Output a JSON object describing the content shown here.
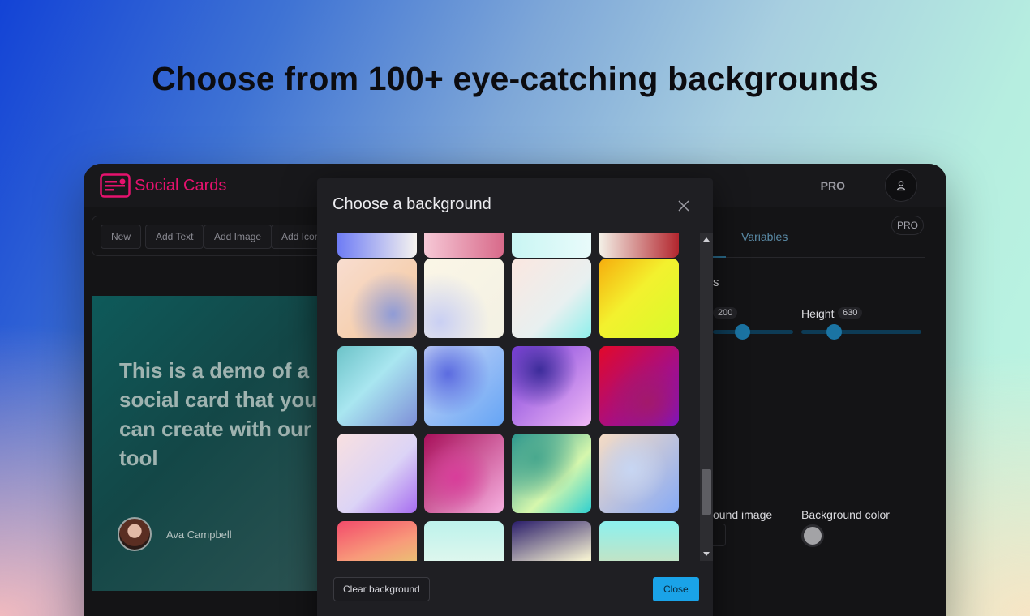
{
  "headline": "Choose from 100+ eye-catching backgrounds",
  "app": {
    "logo_text": "Social Cards",
    "pro_label": "PRO",
    "toolbar": [
      "New",
      "Add Text",
      "Add Image",
      "Add Icon"
    ]
  },
  "card": {
    "text": "This is a demo of a\nsocial card that you\ncan create with our\ntool",
    "author": "Ava Campbell"
  },
  "right_panel": {
    "pro_badge": "PRO",
    "tab_variables": "Variables",
    "section_fragment": "s",
    "width_value_fragment": "200",
    "height_label": "Height",
    "height_value": "630",
    "bg_image_label_fragment": "ound image",
    "bg_color_label": "Background color",
    "bg_color": "#a3a3a6",
    "width_slider_fraction": 0.34,
    "height_slider_fraction": 0.27
  },
  "modal": {
    "title": "Choose a background",
    "clear_label": "Clear background",
    "close_label": "Close",
    "scroll_fraction": 0.85,
    "tiles": [
      [
        "linear-gradient(90deg,#6e7cf5,#f6f3ef)",
        "linear-gradient(90deg,#f6c8d6,#d86a8a)",
        "linear-gradient(90deg,#c9f6f3,#e9fbfb)",
        "linear-gradient(90deg,#f3efe6,#b3262e)"
      ],
      [
        "radial-gradient(circle at 70% 70%,#8f9bd6,transparent 55%),linear-gradient(135deg,#f8ddd0,#f4c79a)",
        "radial-gradient(circle at 20% 80%,#c9cff3,transparent 55%),linear-gradient(135deg,#fbf6e6,#f3f1e4)",
        "linear-gradient(135deg,#fbe7e0,#e8f0f0 60%,#8ff0ec)",
        "linear-gradient(135deg,#f6ad0e,#f3f12e 45%,#d7fb2a)"
      ],
      [
        "linear-gradient(135deg,#6cc3c8,#a9e6f0 45%,#7e8fd8)",
        "radial-gradient(circle at 30% 35%,#5b6be0,transparent 55%),linear-gradient(135deg,#c9d6f6,#66a5f5)",
        "radial-gradient(circle at 35% 30%,#3c2c9a,transparent 50%),linear-gradient(135deg,#7c3ed9,#f0b8f6)",
        "radial-gradient(circle at 60% 70%,#a3196b,transparent 55%),linear-gradient(135deg,#e2082a,#7b14c5)"
      ],
      [
        "linear-gradient(135deg,#f9e0e0,#dcd4f6 55%,#a66cf0)",
        "radial-gradient(circle at 40% 55%,#d83d9a,transparent 55%),linear-gradient(135deg,#a80f5a,#f6b0e0)",
        "radial-gradient(circle at 30% 30%,#49a88e,transparent 55%),linear-gradient(135deg,#1e8f8e,#d6f7ad 60%,#2fd0d0)",
        "radial-gradient(circle at 40% 45%,#c7d6f3,transparent 55%),linear-gradient(135deg,#f6dcc4,#86aaf6)"
      ],
      [
        "linear-gradient(160deg,#f34b6b,#f89a7a 40%,#d6f76b)",
        "linear-gradient(180deg,#bdf2ec,#fdfcef)",
        "linear-gradient(160deg,#2a1d6a,#f2eed0 60%,#f7e9a4)",
        "linear-gradient(180deg,#8cf1ee,#f6d7a0)"
      ]
    ]
  }
}
